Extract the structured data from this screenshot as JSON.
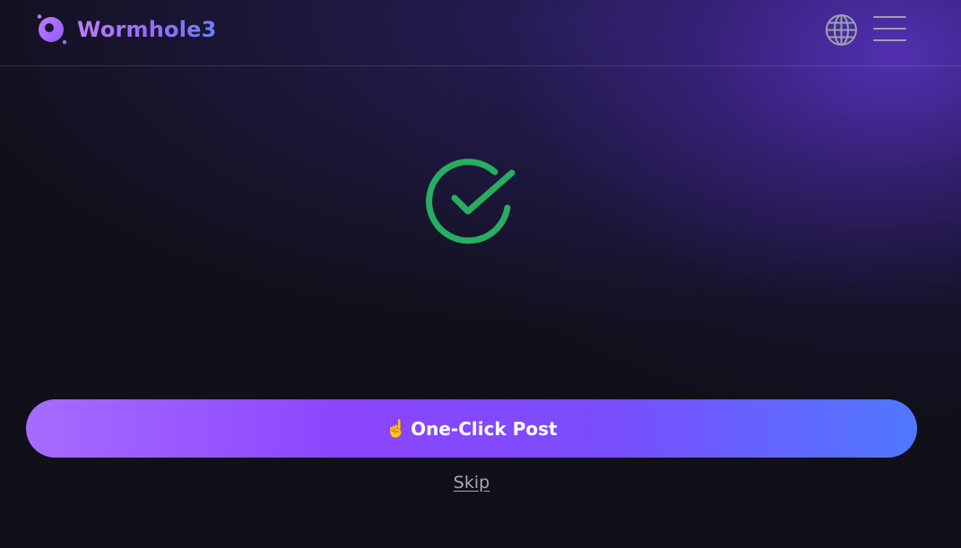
{
  "header": {
    "brand": "Wormhole3",
    "logo_icon": "wormhole-logo-icon",
    "language_icon": "globe-icon",
    "menu_icon": "hamburger-menu-icon"
  },
  "status": {
    "icon": "success-check-icon",
    "color": "#27ae60"
  },
  "actions": {
    "primary_emoji": "☝️",
    "primary_label": "One-Click Post",
    "secondary_label": "Skip"
  },
  "colors": {
    "background": "#10101a",
    "brand_gradient_start": "#c07cff",
    "brand_gradient_end": "#6f7dff",
    "button_gradient_start": "#a66cff",
    "button_gradient_end": "#4f78ff",
    "success": "#27ae60"
  }
}
